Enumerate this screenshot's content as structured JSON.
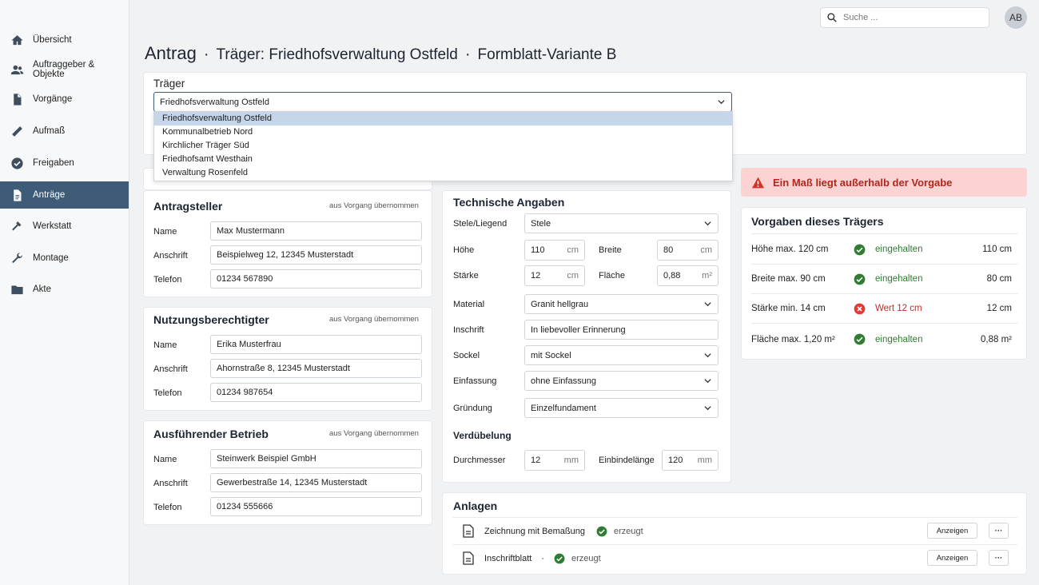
{
  "nav": [
    {
      "label": "Übersicht",
      "icon": "home-icon"
    },
    {
      "label": "Auftraggeber & Objekte",
      "icon": "people-icon"
    },
    {
      "label": "Vorgänge",
      "icon": "document-icon"
    },
    {
      "label": "Aufmaß",
      "icon": "ruler-icon"
    },
    {
      "label": "Freigaben",
      "icon": "check-circle-icon"
    },
    {
      "label": "Anträge",
      "icon": "form-icon"
    },
    {
      "label": "Werkstatt",
      "icon": "hammer-icon"
    },
    {
      "label": "Montage",
      "icon": "wrench-icon"
    },
    {
      "label": "Akte",
      "icon": "folder-icon"
    }
  ],
  "header": {
    "search_placeholder": "Suche ...",
    "avatar": "AB"
  },
  "title": {
    "main": "Antrag",
    "sep": "·",
    "traeger": "Träger: Friedhofsverwaltung Ostfeld",
    "variant": "Formblatt-Variante B"
  },
  "traeger": {
    "label": "Träger",
    "selected": "Friedhofsverwaltung Ostfeld",
    "options": [
      "Friedhofsverwaltung Ostfeld",
      "Kommunalbetrieb Nord",
      "Kirchlicher Träger Süd",
      "Friedhofsamt Westhain",
      "Verwaltung Rosenfeld"
    ]
  },
  "persons": {
    "note": "aus Vorgang übernommen",
    "name_label": "Name",
    "address_label": "Anschrift",
    "phone_label": "Telefon",
    "antragsteller": {
      "title": "Antragsteller",
      "name": "Max Mustermann",
      "address": "Beispielweg 12, 12345 Musterstadt",
      "phone": "01234 567890"
    },
    "nutzung": {
      "title": "Nutzungsberechtigter",
      "name": "Erika Musterfrau",
      "address": "Ahornstraße 8, 12345 Musterstadt",
      "phone": "01234 987654"
    },
    "betrieb": {
      "title": "Ausführender Betrieb",
      "name": "Steinwerk Beispiel GmbH",
      "address": "Gewerbestraße 14, 12345 Musterstadt",
      "phone": "01234 555666"
    }
  },
  "tech": {
    "title": "Technische Angaben",
    "stele_label": "Stele/Liegend",
    "stele_value": "Stele",
    "hoehe_label": "Höhe",
    "hoehe_value": "110",
    "hoehe_unit": "cm",
    "breite_label": "Breite",
    "breite_value": "80",
    "breite_unit": "cm",
    "staerke_label": "Stärke",
    "staerke_value": "12",
    "staerke_unit": "cm",
    "flaeche_label": "Fläche",
    "flaeche_value": "0,88",
    "flaeche_unit": "m²",
    "material_label": "Material",
    "material_value": "Granit hellgrau",
    "inschrift_label": "Inschrift",
    "inschrift_value": "In liebevoller Erinnerung",
    "sockel_label": "Sockel",
    "sockel_value": "mit Sockel",
    "einfassung_label": "Einfassung",
    "einfassung_value": "ohne Einfassung",
    "gruendung_label": "Gründung",
    "gruendung_value": "Einzelfundament",
    "verduebelung": "Verdübelung",
    "durchmesser_label": "Durchmesser",
    "durchmesser_value": "12",
    "durchmesser_unit": "mm",
    "einbinde_label": "Einbindelänge",
    "einbinde_value": "120",
    "einbinde_unit": "mm"
  },
  "alert": "Ein Maß liegt außerhalb der Vorgabe",
  "vorgaben": {
    "title": "Vorgaben dieses Trägers",
    "rows": [
      {
        "label": "Höhe max. 120 cm",
        "status": "eingehalten",
        "ok": true,
        "value": "110 cm"
      },
      {
        "label": "Breite max. 90 cm",
        "status": "eingehalten",
        "ok": true,
        "value": "80 cm"
      },
      {
        "label": "Stärke min. 14 cm",
        "status": "Wert 12 cm",
        "ok": false,
        "value": "12 cm"
      },
      {
        "label": "Fläche max. 1,20 m²",
        "status": "eingehalten",
        "ok": true,
        "value": "0,88 m²"
      }
    ]
  },
  "anlagen": {
    "title": "Anlagen",
    "items": [
      {
        "name": "Zeichnung mit Bemaßung",
        "status": "erzeugt",
        "button": "Anzeigen",
        "more": "···"
      },
      {
        "name": "Inschriftblatt",
        "sep": "·",
        "status": "erzeugt",
        "button": "Anzeigen",
        "more": "···"
      }
    ]
  },
  "colors": {
    "sidebar_active": "#3e5b78",
    "ok": "#2e7d32",
    "error": "#c62828",
    "alert_bg": "#fbd3d3"
  }
}
